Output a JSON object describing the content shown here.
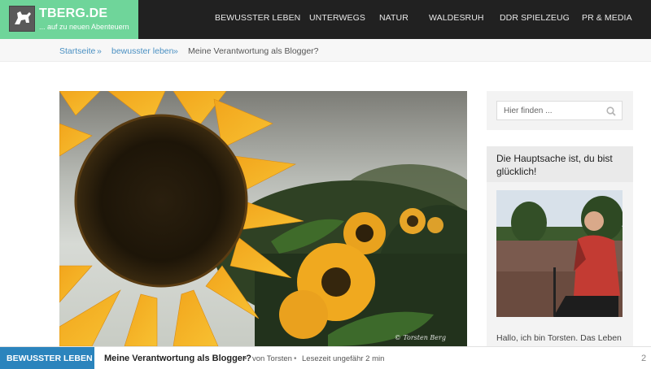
{
  "brand": {
    "title": "TBERG.DE",
    "tagline": "... auf zu neuen Abenteuern",
    "logo_icon": "dog-logo-icon"
  },
  "nav": {
    "items": [
      "BEWUSSTER LEBEN",
      "UNTERWEGS",
      "NATUR",
      "WALDESRUH",
      "DDR SPIELZEUG",
      "PR & MEDIA"
    ]
  },
  "breadcrumb": {
    "home": "Startseite",
    "sep": "»",
    "category": "bewusster leben",
    "current": "Meine Verantwortung als Blogger?"
  },
  "hero": {
    "credit": "© Torsten Berg"
  },
  "sidebar": {
    "search": {
      "placeholder": "Hier finden ...",
      "icon": "search-icon"
    },
    "widget": {
      "title": "Die Hauptsache ist, du bist glücklich!",
      "text": "Hallo,  ich bin Torsten. Das Leben"
    }
  },
  "bottom_bar": {
    "category": "BEWUSSTER LEBEN",
    "title": "Meine Verantwortung als Blogger?",
    "sep": "•",
    "author": "von Torsten",
    "reading_time": "Lesezeit ungefähr 2 min",
    "counter": "2"
  },
  "colors": {
    "brand_green": "#6fd59a",
    "header_dark": "#212121",
    "link_blue": "#4a90c2",
    "badge_blue": "#2b84bd"
  }
}
